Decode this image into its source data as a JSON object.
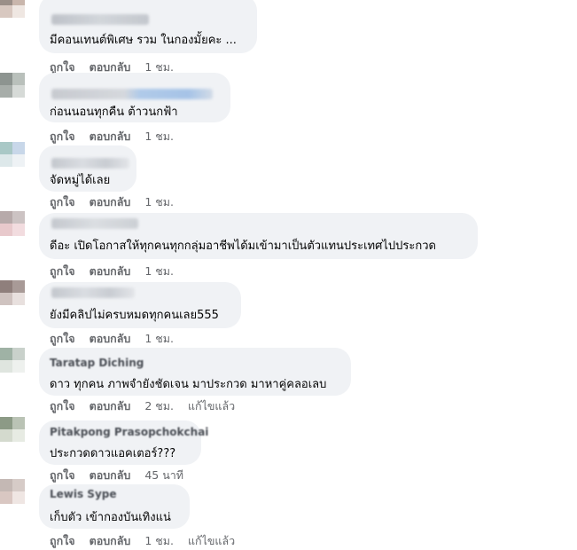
{
  "actions": {
    "like": "ถูกใจ",
    "reply": "ตอบกลับ",
    "edited": "แก้ไขแล้ว"
  },
  "comments": [
    {
      "text": "มีคอนเทนต์พิเศษ รวม ในกองมั้ยคะ ...",
      "time": "1 ชม.",
      "edited": false
    },
    {
      "text": "ก่อนนอนทุกคืน ต้าวนกฟ้า",
      "time": "1 ชม.",
      "edited": false
    },
    {
      "text": "จัดหมู่ได้เลย",
      "time": "1 ชม.",
      "edited": false
    },
    {
      "text": "ดีอะ เปิดโอกาสให้ทุกคนทุกกลุ่มอาชีพได้มเข้ามาเป็นตัวแทนประเทศไปประกวด",
      "time": "1 ชม.",
      "edited": false
    },
    {
      "text": "ยังมีคลิปไม่ครบหมดทุกคนเลย555",
      "time": "1 ชม.",
      "edited": false
    },
    {
      "name": "Taratap Diching",
      "text": "ดาว ทุกคน ภาพจำยังชัดเจน มาประกวด มาหาคู่คลอเลบ",
      "time": "2 ชม.",
      "edited": true
    },
    {
      "name": "Pitakpong Prasopchokchai",
      "text": "ประกวดดาวแอคเตอร์???",
      "time": "45 นาที",
      "edited": false
    },
    {
      "name": "Lewis Sype",
      "text": "เก็บตัว เข้ากองบันเทิงแน่",
      "time": "1 ชม.",
      "edited": true
    }
  ]
}
